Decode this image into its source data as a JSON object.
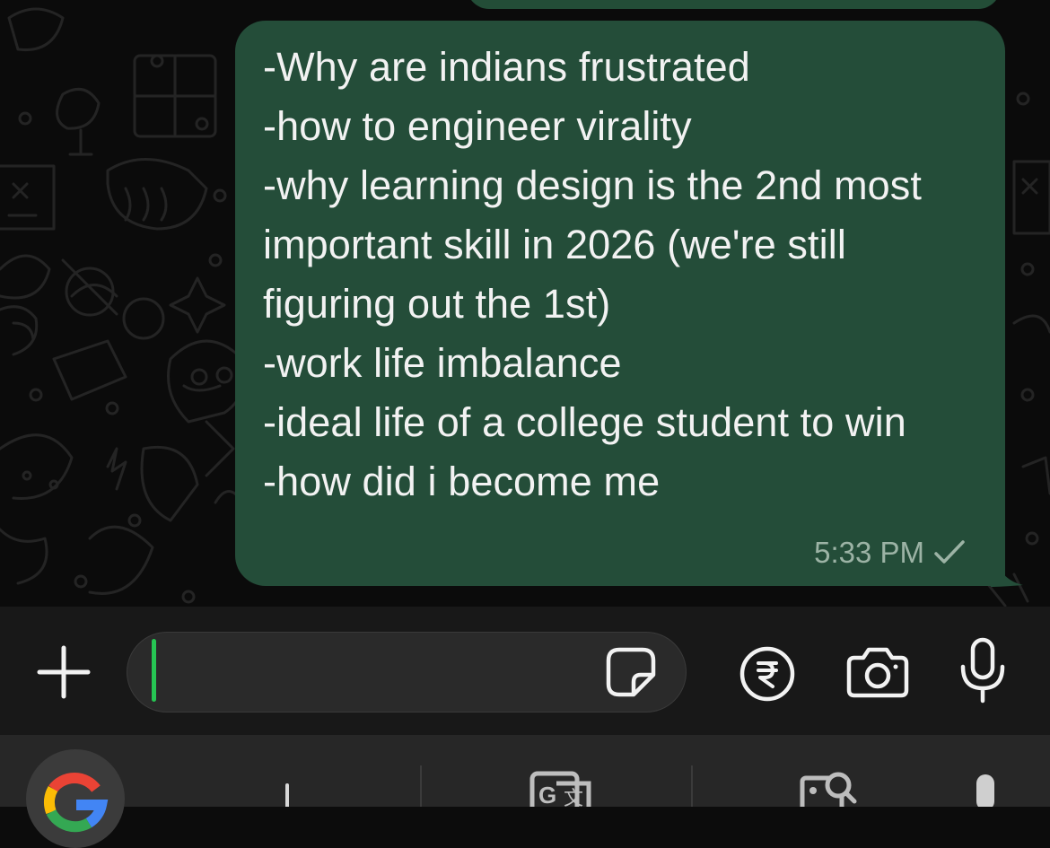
{
  "message": {
    "lines": "-Why are indians frustrated\n-how to engineer virality\n-why learning design is the 2nd most important skill in 2026 (we're still figuring out the 1st)\n-work life imbalance\n-ideal life of a college student to win\n-how did i become me",
    "time": "5:33 PM",
    "status_icon": "single-check-icon"
  },
  "composer": {
    "input_value": "",
    "icons": [
      "plus-icon",
      "sticker-icon",
      "rupee-icon",
      "camera-icon",
      "microphone-icon"
    ]
  },
  "keyboard_toolbar": {
    "icons": [
      "google-icon",
      "gif-icon",
      "translate-icon",
      "image-search-icon",
      "microphone-icon"
    ]
  },
  "colors": {
    "outgoing_bubble": "#244d39",
    "cursor": "#26c653",
    "composer_bg": "#181818",
    "keyboard_bg": "#272727"
  }
}
